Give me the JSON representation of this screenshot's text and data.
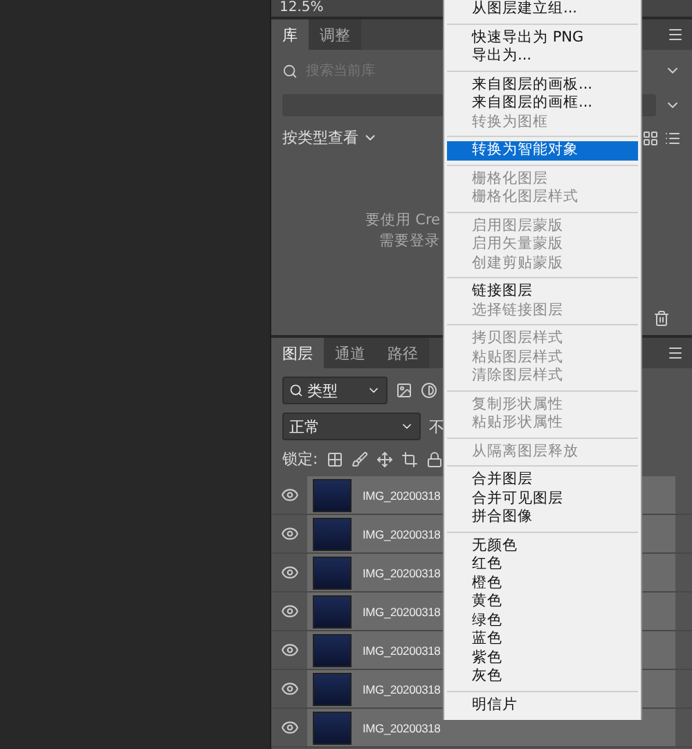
{
  "zoom_bar": {
    "zoom": "12.5%"
  },
  "library_panel": {
    "tabs": [
      {
        "label": "库",
        "selected": true
      },
      {
        "label": "调整",
        "selected": false
      }
    ],
    "search": {
      "placeholder": "搜索当前库"
    },
    "view_by": "按类型查看",
    "message": [
      "要使用 Cre",
      "需要登录"
    ]
  },
  "layers_panel": {
    "tabs": [
      {
        "label": "图层",
        "selected": true
      },
      {
        "label": "通道",
        "selected": false
      },
      {
        "label": "路径",
        "selected": false
      }
    ],
    "filter": "类型",
    "blend_mode": "正常",
    "opacity_label": "不",
    "lock_label": "锁定:",
    "layers": [
      {
        "name": "IMG_20200318",
        "visible": true,
        "selected": true
      },
      {
        "name": "IMG_20200318",
        "visible": true,
        "selected": true
      },
      {
        "name": "IMG_20200318",
        "visible": true,
        "selected": true
      },
      {
        "name": "IMG_20200318",
        "visible": true,
        "selected": true
      },
      {
        "name": "IMG_20200318",
        "visible": true,
        "selected": true
      },
      {
        "name": "IMG_20200318",
        "visible": true,
        "selected": true
      },
      {
        "name": "IMG_20200318",
        "visible": true,
        "selected": true
      }
    ]
  },
  "context_menu": {
    "groups": [
      [
        {
          "label": "从图层建立组...",
          "disabled": false,
          "selected": false
        }
      ],
      [
        {
          "label": "快速导出为 PNG",
          "disabled": false,
          "selected": false
        },
        {
          "label": "导出为...",
          "disabled": false,
          "selected": false
        }
      ],
      [
        {
          "label": "来自图层的画板...",
          "disabled": false,
          "selected": false
        },
        {
          "label": "来自图层的画框...",
          "disabled": false,
          "selected": false
        },
        {
          "label": "转换为图框",
          "disabled": true,
          "selected": false
        }
      ],
      [
        {
          "label": "转换为智能对象",
          "disabled": false,
          "selected": true
        }
      ],
      [
        {
          "label": "栅格化图层",
          "disabled": true,
          "selected": false
        },
        {
          "label": "栅格化图层样式",
          "disabled": true,
          "selected": false
        }
      ],
      [
        {
          "label": "启用图层蒙版",
          "disabled": true,
          "selected": false
        },
        {
          "label": "启用矢量蒙版",
          "disabled": true,
          "selected": false
        },
        {
          "label": "创建剪贴蒙版",
          "disabled": true,
          "selected": false
        }
      ],
      [
        {
          "label": "链接图层",
          "disabled": false,
          "selected": false
        },
        {
          "label": "选择链接图层",
          "disabled": true,
          "selected": false
        }
      ],
      [
        {
          "label": "拷贝图层样式",
          "disabled": true,
          "selected": false
        },
        {
          "label": "粘贴图层样式",
          "disabled": true,
          "selected": false
        },
        {
          "label": "清除图层样式",
          "disabled": true,
          "selected": false
        }
      ],
      [
        {
          "label": "复制形状属性",
          "disabled": true,
          "selected": false
        },
        {
          "label": "粘贴形状属性",
          "disabled": true,
          "selected": false
        }
      ],
      [
        {
          "label": "从隔离图层释放",
          "disabled": true,
          "selected": false
        }
      ],
      [
        {
          "label": "合并图层",
          "disabled": false,
          "selected": false
        },
        {
          "label": "合并可见图层",
          "disabled": false,
          "selected": false
        },
        {
          "label": "拼合图像",
          "disabled": false,
          "selected": false
        }
      ],
      [
        {
          "label": "无颜色",
          "disabled": false,
          "selected": false
        },
        {
          "label": "红色",
          "disabled": false,
          "selected": false
        },
        {
          "label": "橙色",
          "disabled": false,
          "selected": false
        },
        {
          "label": "黄色",
          "disabled": false,
          "selected": false
        },
        {
          "label": "绿色",
          "disabled": false,
          "selected": false
        },
        {
          "label": "蓝色",
          "disabled": false,
          "selected": false
        },
        {
          "label": "紫色",
          "disabled": false,
          "selected": false
        },
        {
          "label": "灰色",
          "disabled": false,
          "selected": false
        }
      ],
      [
        {
          "label": "明信片",
          "disabled": false,
          "selected": false
        }
      ]
    ]
  }
}
